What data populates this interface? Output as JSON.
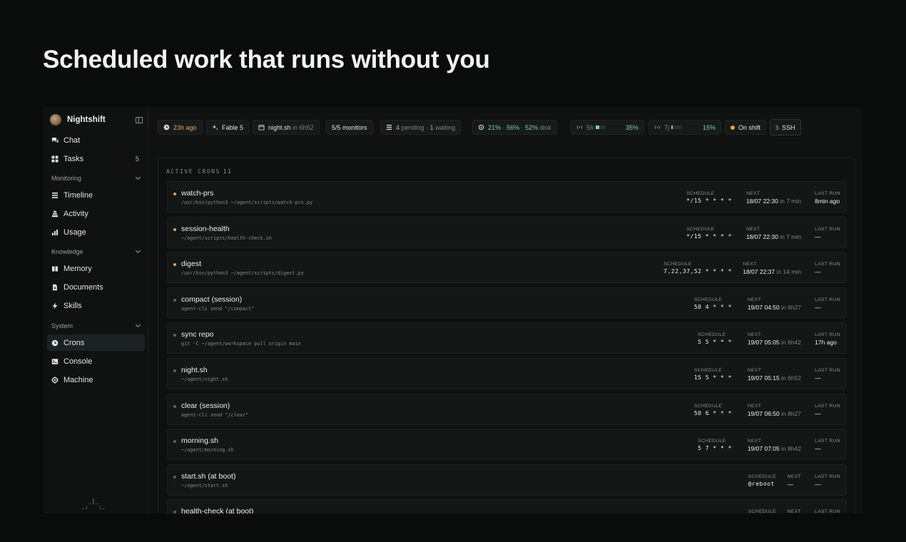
{
  "headline": "Scheduled work that runs without you",
  "sidebar": {
    "app_name": "Nightshift",
    "top": [
      {
        "label": "Chat",
        "icon": "chat-icon"
      },
      {
        "label": "Tasks",
        "icon": "grid-icon",
        "badge": "5"
      }
    ],
    "sections": [
      {
        "label": "Monitoring",
        "items": [
          {
            "label": "Timeline",
            "icon": "list-icon"
          },
          {
            "label": "Activity",
            "icon": "stack-icon"
          },
          {
            "label": "Usage",
            "icon": "bar-chart-icon"
          }
        ]
      },
      {
        "label": "Knowledge",
        "items": [
          {
            "label": "Memory",
            "icon": "book-icon"
          },
          {
            "label": "Documents",
            "icon": "document-icon"
          },
          {
            "label": "Skills",
            "icon": "bolt-icon"
          }
        ]
      },
      {
        "label": "System",
        "items": [
          {
            "label": "Crons",
            "icon": "clock-icon",
            "active": true
          },
          {
            "label": "Console",
            "icon": "terminal-icon"
          },
          {
            "label": "Machine",
            "icon": "cpu-icon"
          }
        ]
      }
    ],
    "ascii_art": "  _|_\n.:   :."
  },
  "topbar": {
    "last_seen": "23h ago",
    "model": "Fable 5",
    "next_job": "night.sh",
    "next_job_in": "in 6h52",
    "monitors": "5/5 monitors",
    "pending_count": "4",
    "pending_label": "pending",
    "waiting_count": "1",
    "waiting_label": "waiting",
    "cpu": "21%",
    "mem": "56%",
    "disk": "52%",
    "disk_label": "disk",
    "usage_5h_label": "5h",
    "usage_5h": "35%",
    "usage_5h_fraction": 0.35,
    "usage_7d_label": "7j",
    "usage_7d": "15%",
    "usage_7d_fraction": 0.15,
    "shift": "On shift",
    "ssh": "SSH",
    "colors": {
      "accent_orange": "#e9a55a",
      "accent_green": "#7ed1a4",
      "shift_dot": "#e9a53a"
    }
  },
  "crons": {
    "title": "ACTIVE CRONS",
    "count": "11",
    "labels": {
      "schedule": "SCHEDULE",
      "next": "NEXT",
      "last_run": "LAST RUN"
    },
    "rows": [
      {
        "name": "watch-prs",
        "cmd": "/usr/bin/python3 ~/agent/scripts/watch-prs.py",
        "schedule": "*/15 * * * *",
        "next": "18/07 22:30",
        "next_in": "in 7 min",
        "last_run": "8min ago",
        "status": "active"
      },
      {
        "name": "session-health",
        "cmd": "~/agent/scripts/health-check.sh",
        "schedule": "*/15 * * * *",
        "next": "18/07 22:30",
        "next_in": "in 7 min",
        "last_run": "—",
        "status": "active"
      },
      {
        "name": "digest",
        "cmd": "/usr/bin/python3 ~/agent/scripts/digest.py",
        "schedule": "7,22,37,52 * * * *",
        "next": "18/07 22:37",
        "next_in": "in 14 min",
        "last_run": "—",
        "status": "active"
      },
      {
        "name": "compact (session)",
        "cmd": "agent-cli send \"/compact\"",
        "schedule": "50 4 * * *",
        "next": "19/07 04:50",
        "next_in": "in 6h27",
        "last_run": "—",
        "status": "idle"
      },
      {
        "name": "sync repo",
        "cmd": "git -C ~/agent/workspace pull origin main",
        "schedule": "5 5 * * *",
        "next": "19/07 05:05",
        "next_in": "in 6h42",
        "last_run": "17h ago",
        "status": "idle"
      },
      {
        "name": "night.sh",
        "cmd": "~/agent/night.sh",
        "schedule": "15 5 * * *",
        "next": "19/07 05:15",
        "next_in": "in 6h52",
        "last_run": "—",
        "status": "idle"
      },
      {
        "name": "clear (session)",
        "cmd": "agent-cli send \"/clear\"",
        "schedule": "50 6 * * *",
        "next": "19/07 06:50",
        "next_in": "in 8h27",
        "last_run": "—",
        "status": "idle"
      },
      {
        "name": "morning.sh",
        "cmd": "~/agent/morning.sh",
        "schedule": "5 7 * * *",
        "next": "19/07 07:05",
        "next_in": "in 8h42",
        "last_run": "—",
        "status": "idle"
      },
      {
        "name": "start.sh (at boot)",
        "cmd": "~/agent/start.sh",
        "schedule": "@reboot",
        "next": "—",
        "next_in": "",
        "last_run": "—",
        "status": "idle"
      },
      {
        "name": "health-check (at boot)",
        "cmd": "",
        "schedule": "",
        "next": "",
        "next_in": "",
        "last_run": "",
        "status": "idle"
      }
    ]
  }
}
